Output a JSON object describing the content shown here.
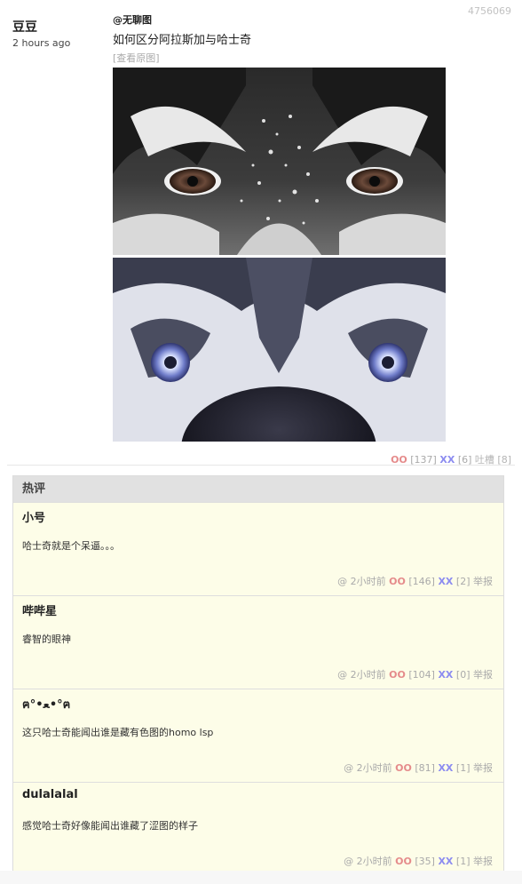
{
  "post": {
    "id": "4756069",
    "author": "豆豆",
    "time": "2 hours ago",
    "at": "@无聊图",
    "text": "如何区分阿拉斯加与哈士奇",
    "view_original": "[查看原图]",
    "oo_label": "OO",
    "oo_count": "[137]",
    "xx_label": "XX",
    "xx_count": "[6]",
    "tucao": "吐槽 [8]"
  },
  "hot": {
    "title": "热评",
    "comments": [
      {
        "user": "小号",
        "text": "哈士奇就是个呆逼。。。",
        "at": "@",
        "time": "2小时前",
        "oo": "OO",
        "oo_count": "[146]",
        "xx": "XX",
        "xx_count": "[2]",
        "report": "举报"
      },
      {
        "user": "哔哔星",
        "text": "睿智的眼神",
        "at": "@",
        "time": "2小时前",
        "oo": "OO",
        "oo_count": "[104]",
        "xx": "XX",
        "xx_count": "[0]",
        "report": "举报"
      },
      {
        "user": "ฅ°•ﻌ•°ฅ",
        "text": "这只哈士奇能闻出谁是藏有色图的homo lsp",
        "at": "@",
        "time": "2小时前",
        "oo": "OO",
        "oo_count": "[81]",
        "xx": "XX",
        "xx_count": "[1]",
        "report": "举报"
      },
      {
        "user": "dulalalal",
        "text": "感觉哈士奇好像能闻出谁藏了涩图的样子",
        "at": "@",
        "time": "2小时前",
        "oo": "OO",
        "oo_count": "[35]",
        "xx": "XX",
        "xx_count": "[1]",
        "report": "举报"
      }
    ]
  }
}
